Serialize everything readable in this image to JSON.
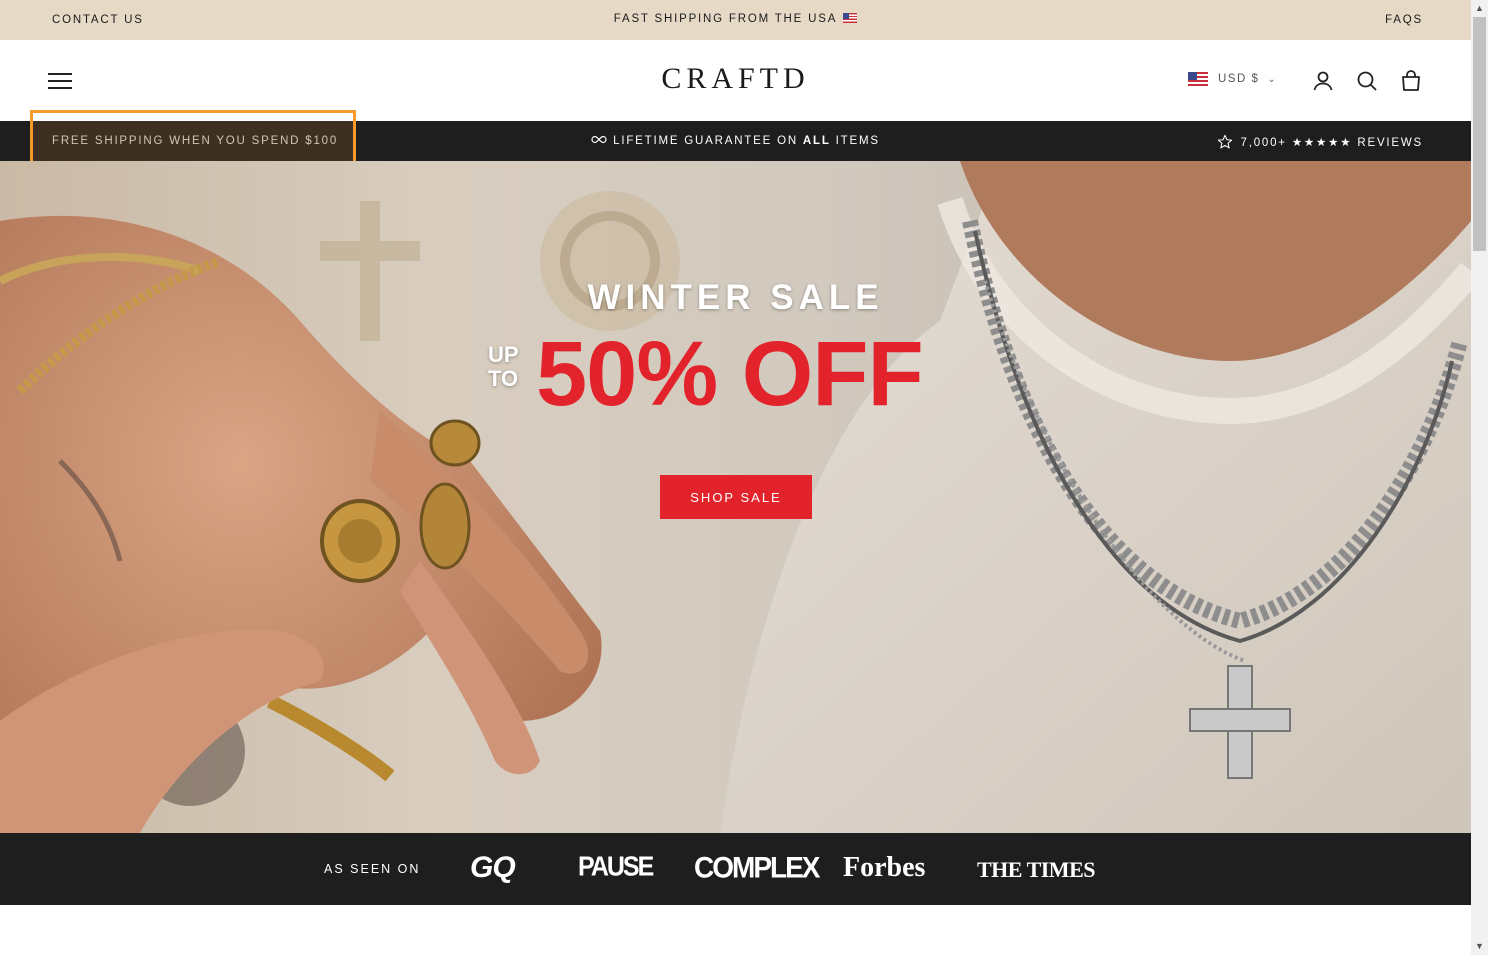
{
  "announcement": {
    "contact": "CONTACT US",
    "center": "FAST SHIPPING FROM THE USA",
    "faqs": "FAQS"
  },
  "header": {
    "logo": "CRAFTD",
    "currency": "USD $",
    "icons": [
      "menu-icon",
      "account-icon",
      "search-icon",
      "cart-icon"
    ]
  },
  "promo": {
    "left": "FREE SHIPPING WHEN YOU SPEND $100",
    "center_prefix": "LIFETIME GUARANTEE ON ",
    "center_bold": "ALL",
    "center_suffix": " ITEMS",
    "right": "7,000+ ★★★★★ REVIEWS"
  },
  "hero": {
    "title": "WINTER SALE",
    "upto_line1": "UP",
    "upto_line2": "TO",
    "discount": "50% OFF",
    "button": "SHOP SALE"
  },
  "press": {
    "label": "AS SEEN ON",
    "logos": [
      "GQ",
      "PAUSE",
      "COMPLEX",
      "Forbes",
      "THE TIMES"
    ]
  },
  "colors": {
    "announcement_bg": "#e6dac6",
    "dark_bar": "#1e1e1e",
    "sale_red": "#e3232b",
    "highlight_box": "#f39a2a"
  }
}
